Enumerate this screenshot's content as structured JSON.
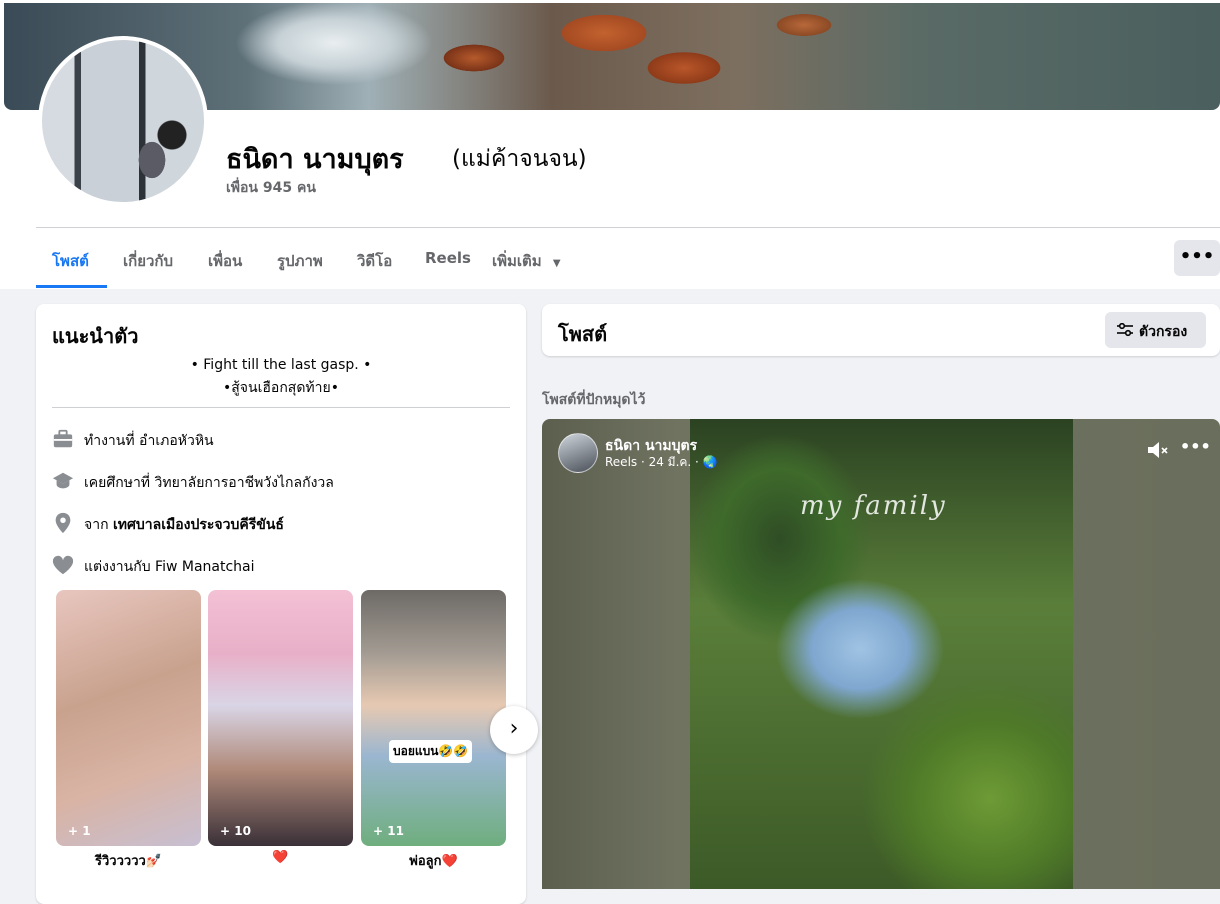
{
  "profile": {
    "name": "ธนิดา นามบุตร",
    "alternate_name": "(แม่ค้าจนจน)",
    "friends": "เพื่อน 945 คน"
  },
  "tabs": [
    {
      "label": "โพสต์",
      "active": true
    },
    {
      "label": "เกี่ยวกับ"
    },
    {
      "label": "เพื่อน"
    },
    {
      "label": "รูปภาพ"
    },
    {
      "label": "วิดีโอ"
    },
    {
      "label": "Reels"
    },
    {
      "label": "เพิ่มเติม"
    }
  ],
  "more_actions_label": "•••",
  "intro": {
    "title": "แนะนำตัว",
    "bio_line1": "• Fight till the last gasp. •",
    "bio_line2": "•สู้จนเฮือกสุดท้าย•",
    "work_prefix": "ทำงานที่ ",
    "work_value": "อำเภอหัวหิน",
    "study_prefix": "เคยศึกษาที่ ",
    "study_value": "วิทยาลัยการอาชีพวังไกลกังวล",
    "from_prefix": "จาก ",
    "from_value": "เทศบาลเมืองประจวบคีรีขันธ์",
    "rel_prefix": "แต่งงานกับ ",
    "rel_value": "Fiw Manatchai"
  },
  "featured": [
    {
      "count": "+ 1",
      "label": "รีวิววววว💅🏻"
    },
    {
      "count": "+ 10",
      "label": "❤️"
    },
    {
      "count": "+ 11",
      "label": "พ่อลูก❤️",
      "sticker": "บอยแบน🤣🤣"
    }
  ],
  "featured_next_icon": "›",
  "posts": {
    "title": "โพสต์",
    "filter_label": "ตัวกรอง",
    "pinned_label": "โพสต์ที่ปักหมุดไว้"
  },
  "reel": {
    "author": "ธนิดา นามบุตร",
    "meta": "Reels · 24 มี.ค. · 🌏",
    "watermark": "my family",
    "more_label": "•••"
  },
  "colors": {
    "accent": "#1877f2",
    "background": "#f0f2f5",
    "secondary_text": "#65676b"
  }
}
